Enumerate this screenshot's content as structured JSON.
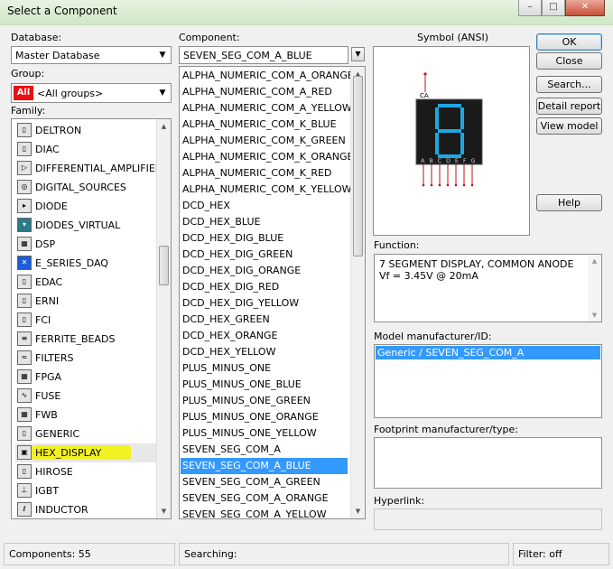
{
  "window": {
    "title": "Select a Component",
    "min_symbol": "–",
    "max_symbol": "□",
    "close_symbol": "✕"
  },
  "database": {
    "label": "Database:",
    "value": "Master Database"
  },
  "group": {
    "label": "Group:",
    "value": "<All groups>",
    "badge": "All"
  },
  "family": {
    "label": "Family:",
    "items": [
      {
        "label": "DELTRON",
        "icon": "connector-icon"
      },
      {
        "label": "DIAC",
        "icon": "connector-icon"
      },
      {
        "label": "DIFFERENTIAL_AMPLIFIER",
        "icon": "amplifier-icon"
      },
      {
        "label": "DIGITAL_SOURCES",
        "icon": "digital-source-icon"
      },
      {
        "label": "DIODE",
        "icon": "diode-icon"
      },
      {
        "label": "DIODES_VIRTUAL",
        "icon": "diode-virtual-icon"
      },
      {
        "label": "DSP",
        "icon": "chip-icon"
      },
      {
        "label": "E_SERIES_DAQ",
        "icon": "ni-logo-icon"
      },
      {
        "label": "EDAC",
        "icon": "connector-icon"
      },
      {
        "label": "ERNI",
        "icon": "connector-icon"
      },
      {
        "label": "FCI",
        "icon": "connector-icon"
      },
      {
        "label": "FERRITE_BEADS",
        "icon": "ferrite-icon"
      },
      {
        "label": "FILTERS",
        "icon": "filter-icon"
      },
      {
        "label": "FPGA",
        "icon": "chip-icon"
      },
      {
        "label": "FUSE",
        "icon": "fuse-icon"
      },
      {
        "label": "FWB",
        "icon": "chip-icon"
      },
      {
        "label": "GENERIC",
        "icon": "connector-icon"
      },
      {
        "label": "HEX_DISPLAY",
        "icon": "display-icon"
      },
      {
        "label": "HIROSE",
        "icon": "connector-icon"
      },
      {
        "label": "IGBT",
        "icon": "transistor-icon"
      },
      {
        "label": "INDUCTOR",
        "icon": "inductor-icon"
      }
    ]
  },
  "component": {
    "label": "Component:",
    "search_value": "SEVEN_SEG_COM_A_BLUE",
    "filter_icon": "filter-icon",
    "items": [
      "ALPHA_NUMERIC_COM_A_ORANGE",
      "ALPHA_NUMERIC_COM_A_RED",
      "ALPHA_NUMERIC_COM_A_YELLOW",
      "ALPHA_NUMERIC_COM_K_BLUE",
      "ALPHA_NUMERIC_COM_K_GREEN",
      "ALPHA_NUMERIC_COM_K_ORANGE",
      "ALPHA_NUMERIC_COM_K_RED",
      "ALPHA_NUMERIC_COM_K_YELLOW",
      "DCD_HEX",
      "DCD_HEX_BLUE",
      "DCD_HEX_DIG_BLUE",
      "DCD_HEX_DIG_GREEN",
      "DCD_HEX_DIG_ORANGE",
      "DCD_HEX_DIG_RED",
      "DCD_HEX_DIG_YELLOW",
      "DCD_HEX_GREEN",
      "DCD_HEX_ORANGE",
      "DCD_HEX_YELLOW",
      "PLUS_MINUS_ONE",
      "PLUS_MINUS_ONE_BLUE",
      "PLUS_MINUS_ONE_GREEN",
      "PLUS_MINUS_ONE_ORANGE",
      "PLUS_MINUS_ONE_YELLOW",
      "SEVEN_SEG_COM_A",
      "SEVEN_SEG_COM_A_BLUE",
      "SEVEN_SEG_COM_A_GREEN",
      "SEVEN_SEG_COM_A_ORANGE",
      "SEVEN_SEG_COM_A_YELLOW"
    ],
    "selected": "SEVEN_SEG_COM_A_BLUE"
  },
  "symbol": {
    "label": "Symbol (ANSI)",
    "pin_ca": "CA",
    "pins": "A B C D E F G",
    "segment_color": "#1ea8e0"
  },
  "buttons": {
    "ok": "OK",
    "close": "Close",
    "search": "Search...",
    "detail_report": "Detail report",
    "view_model": "View model",
    "help": "Help"
  },
  "function": {
    "label": "Function:",
    "line1": "7 SEGMENT DISPLAY, COMMON ANODE",
    "line2": "Vf = 3.45V @ 20mA"
  },
  "model": {
    "label": "Model manufacturer/ID:",
    "value": "Generic / SEVEN_SEG_COM_A"
  },
  "footprint": {
    "label": "Footprint manufacturer/type:"
  },
  "hyperlink": {
    "label": "Hyperlink:"
  },
  "status": {
    "components": "Components: 55",
    "searching": "Searching:",
    "filter": "Filter: off"
  },
  "colors": {
    "selection": "#3399ff",
    "highlight": "#f3f200",
    "all_badge": "#e81010"
  }
}
